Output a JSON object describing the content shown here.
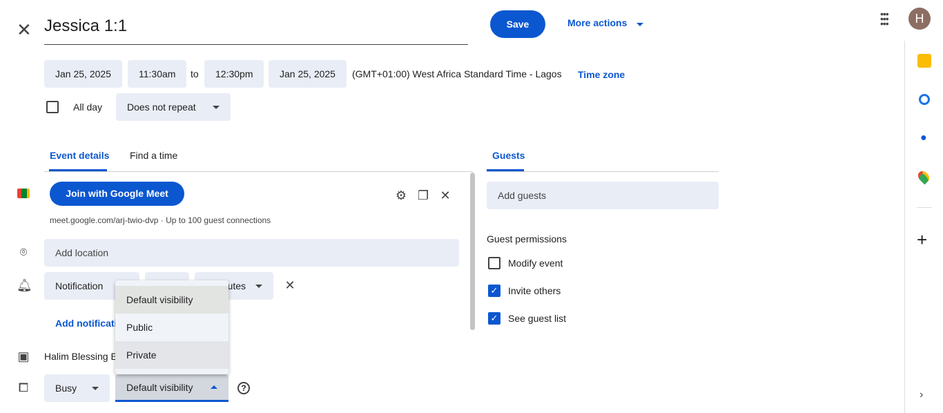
{
  "header": {
    "title": "Jessica 1:1",
    "save": "Save",
    "more_actions": "More actions",
    "avatar_letter": "H"
  },
  "datetime": {
    "start_date": "Jan 25, 2025",
    "start_time": "11:30am",
    "to": "to",
    "end_time": "12:30pm",
    "end_date": "Jan 25, 2025",
    "timezone": "(GMT+01:00) West Africa Standard Time - Lagos",
    "timezone_link": "Time zone",
    "all_day": "All day",
    "repeat": "Does not repeat"
  },
  "tabs": {
    "event_details": "Event details",
    "find_time": "Find a time",
    "guests": "Guests"
  },
  "meet": {
    "join": "Join with Google Meet",
    "link": "meet.google.com/arj-twio-dvp · Up to 100 guest connections"
  },
  "location_placeholder": "Add location",
  "notification": {
    "type": "Notification",
    "unit": "utes",
    "add": "Add notificati"
  },
  "calendar_owner": "Halim Blessing E",
  "status": {
    "busy": "Busy",
    "visibility": "Default visibility"
  },
  "visibility_menu": [
    "Default visibility",
    "Public",
    "Private"
  ],
  "guests": {
    "placeholder": "Add guests",
    "permissions_title": "Guest permissions",
    "permissions": [
      {
        "label": "Modify event",
        "checked": false
      },
      {
        "label": "Invite others",
        "checked": true
      },
      {
        "label": "See guest list",
        "checked": true
      }
    ]
  },
  "colors": {
    "accent": "#0b57d0"
  }
}
